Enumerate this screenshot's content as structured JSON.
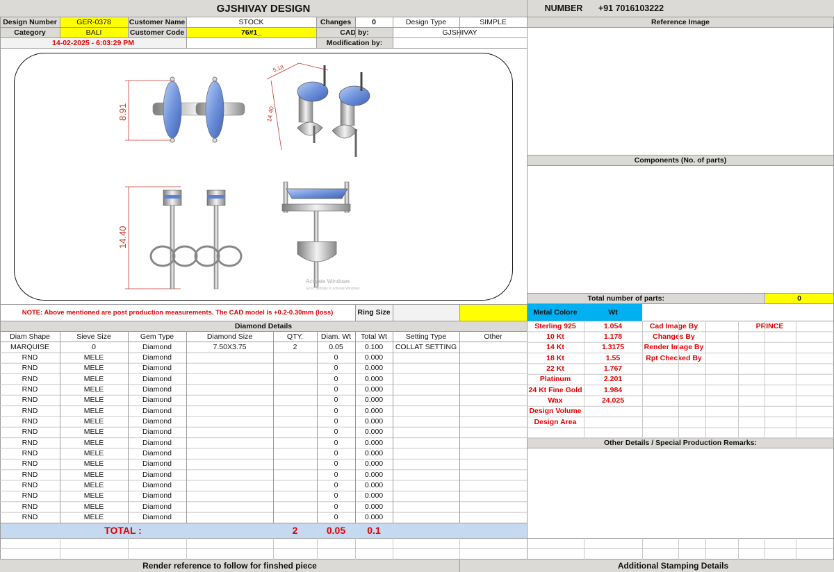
{
  "header": {
    "title": "GJSHIVAY DESIGN",
    "number_label": "NUMBER",
    "number_value": "+91 7016103222"
  },
  "info": {
    "design_number_label": "Design Number",
    "design_number": "GER-0378",
    "customer_name_label": "Customer Name",
    "customer_name": "STOCK",
    "changes_label": "Changes",
    "changes": "0",
    "design_type_label": "Design Type",
    "design_type": "SIMPLE",
    "category_label": "Category",
    "category": "BALI",
    "customer_code_label": "Customer Code",
    "customer_code": "76#1_",
    "cad_by_label": "CAD by:",
    "cad_by": "GJSHIVAY",
    "timestamp": "14-02-2025 - 6:03:29 PM",
    "modification_label": "Modification by:"
  },
  "cad": {
    "dim_top_left": "8.91",
    "dim_top_right_a": "5.18",
    "dim_top_right_b": "14.40",
    "dim_bottom_left": "14.40",
    "watermark_line1": "Activate Windows",
    "watermark_line2": "Go to Settings to activate Windows."
  },
  "note": {
    "text": "NOTE: Above mentioned are post production measurements. The CAD model is +0.2-0.30mm (loss)",
    "ring_size_label": "Ring Size"
  },
  "right": {
    "reference_image": "Reference Image",
    "components": "Components (No. of parts)",
    "total_parts_label": "Total number of parts:",
    "total_parts": "0",
    "metal_colore": "Metal Colore",
    "wt": "Wt",
    "other_details": "Other Details / Special Production Remarks:",
    "additional_stamping": "Additional Stamping Details"
  },
  "metals": [
    {
      "name": "Sterling 925",
      "wt": "1.054"
    },
    {
      "name": "10 Kt",
      "wt": "1.178"
    },
    {
      "name": "14 Kt",
      "wt": "1.3175"
    },
    {
      "name": "18 Kt",
      "wt": "1.55"
    },
    {
      "name": "22 Kt",
      "wt": "1.767"
    },
    {
      "name": "Platinum",
      "wt": "2.201"
    },
    {
      "name": "24 Kt Fine Gold",
      "wt": "1.984"
    },
    {
      "name": "Wax",
      "wt": "24.025"
    },
    {
      "name": "Design Volume",
      "wt": ""
    },
    {
      "name": "Design Area",
      "wt": ""
    }
  ],
  "roles": [
    {
      "label": "Cad Image By",
      "value": "PRINCE"
    },
    {
      "label": "Changes By",
      "value": ""
    },
    {
      "label": "Render Image By",
      "value": ""
    },
    {
      "label": "Rpt Checked By",
      "value": ""
    }
  ],
  "diamond": {
    "title": "Diamond Details",
    "columns": [
      "Diam Shape",
      "Sieve Size",
      "Gem Type",
      "Diamond Size",
      "QTY.",
      "Diam. Wt",
      "Total Wt",
      "Setting Type",
      "Other"
    ],
    "rows": [
      [
        "MARQUISE",
        "0",
        "Diamond",
        "7.50X3.75",
        "2",
        "0.05",
        "0.100",
        "COLLAT SETTING",
        ""
      ],
      [
        "RND",
        "MELE",
        "Diamond",
        "",
        "",
        "0",
        "0.000",
        "",
        ""
      ],
      [
        "RND",
        "MELE",
        "Diamond",
        "",
        "",
        "0",
        "0.000",
        "",
        ""
      ],
      [
        "RND",
        "MELE",
        "Diamond",
        "",
        "",
        "0",
        "0.000",
        "",
        ""
      ],
      [
        "RND",
        "MELE",
        "Diamond",
        "",
        "",
        "0",
        "0.000",
        "",
        ""
      ],
      [
        "RND",
        "MELE",
        "Diamond",
        "",
        "",
        "0",
        "0.000",
        "",
        ""
      ],
      [
        "RND",
        "MELE",
        "Diamond",
        "",
        "",
        "0",
        "0.000",
        "",
        ""
      ],
      [
        "RND",
        "MELE",
        "Diamond",
        "",
        "",
        "0",
        "0.000",
        "",
        ""
      ],
      [
        "RND",
        "MELE",
        "Diamond",
        "",
        "",
        "0",
        "0.000",
        "",
        ""
      ],
      [
        "RND",
        "MELE",
        "Diamond",
        "",
        "",
        "0",
        "0.000",
        "",
        ""
      ],
      [
        "RND",
        "MELE",
        "Diamond",
        "",
        "",
        "0",
        "0.000",
        "",
        ""
      ],
      [
        "RND",
        "MELE",
        "Diamond",
        "",
        "",
        "0",
        "0.000",
        "",
        ""
      ],
      [
        "RND",
        "MELE",
        "Diamond",
        "",
        "",
        "0",
        "0.000",
        "",
        ""
      ],
      [
        "RND",
        "MELE",
        "Diamond",
        "",
        "",
        "0",
        "0.000",
        "",
        ""
      ],
      [
        "RND",
        "MELE",
        "Diamond",
        "",
        "",
        "0",
        "0.000",
        "",
        ""
      ],
      [
        "RND",
        "MELE",
        "Diamond",
        "",
        "",
        "0",
        "0.000",
        "",
        ""
      ],
      [
        "RND",
        "MELE",
        "Diamond",
        "",
        "",
        "0",
        "0.000",
        "",
        ""
      ]
    ],
    "total_label": "TOTAL :",
    "total_qty": "2",
    "total_diam_wt": "0.05",
    "total_wt": "0.1"
  },
  "footer": {
    "render_reference": "Render reference to follow for finshed piece"
  },
  "colors": {
    "header_grey": "#dcdad6",
    "highlight_yellow": "#ffff00",
    "metal_blue": "#00b0f0",
    "total_row_blue": "#c5d9f1",
    "label_red": "#e00000"
  }
}
